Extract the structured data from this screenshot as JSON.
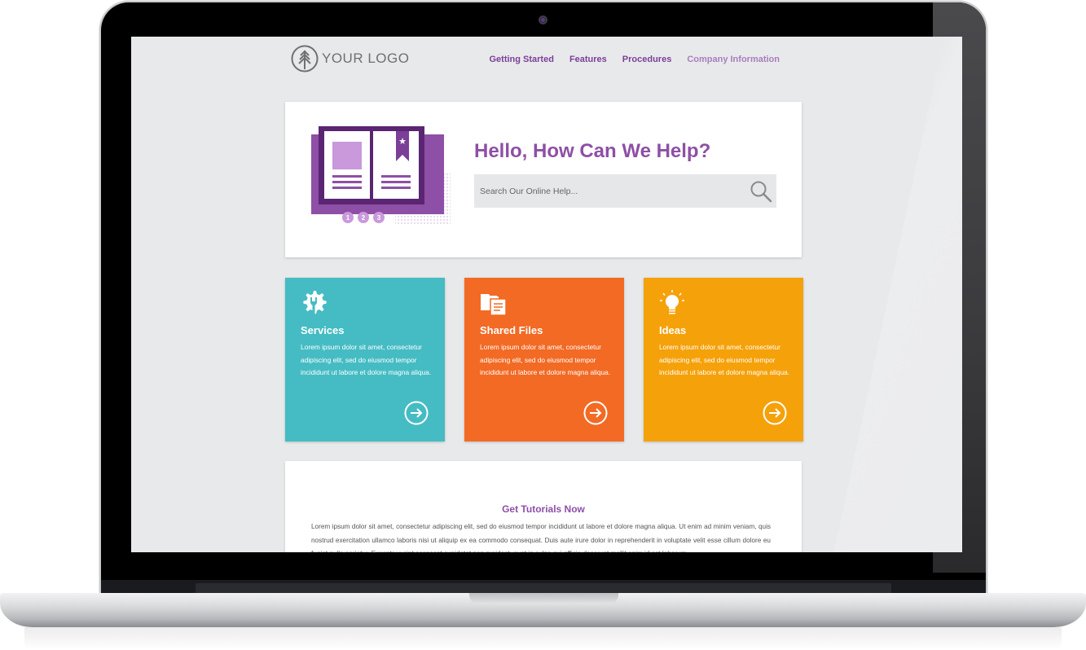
{
  "header": {
    "logo_text": "YOUR LOGO",
    "nav": [
      {
        "label": "Getting Started"
      },
      {
        "label": "Features"
      },
      {
        "label": "Procedures"
      },
      {
        "label": "Company Information"
      }
    ]
  },
  "hero": {
    "title": "Hello, How Can We Help?",
    "search_placeholder": "Search Our Online Help...",
    "search_value": "",
    "steps": [
      "1",
      "2",
      "3"
    ]
  },
  "tiles": [
    {
      "icon": "wrench-gear-icon",
      "title": "Services",
      "body": "Lorem ipsum dolor sit amet, consectetur adipiscing elit, sed do eiusmod tempor incididunt ut labore et dolore magna aliqua.",
      "color": "#45bcc3"
    },
    {
      "icon": "files-icon",
      "title": "Shared Files",
      "body": "Lorem ipsum dolor sit amet, consectetur adipiscing elit, sed do eiusmod tempor incididunt ut labore et dolore magna aliqua.",
      "color": "#f26a24"
    },
    {
      "icon": "lightbulb-icon",
      "title": "Ideas",
      "body": "Lorem ipsum dolor sit amet, consectetur adipiscing elit, sed do eiusmod tempor incididunt ut labore et dolore magna aliqua.",
      "color": "#f5a10a"
    }
  ],
  "tutorials": {
    "title": "Get Tutorials Now",
    "body": "Lorem ipsum dolor sit amet, consectetur adipiscing elit, sed do eiusmod tempor incididunt ut labore et dolore magna aliqua. Ut enim ad minim veniam, quis nostrud exercitation ullamco laboris nisi ut aliquip ex ea commodo consequat. Duis aute irure dolor in reprehenderit in voluptate velit esse cillum dolore eu fugiat nulla pariatur. Excepteur sint occaecat cupidatat non proident, sunt in culpa qui officia deserunt mollit anim id est laborum."
  },
  "colors": {
    "accent": "#8e4fa6",
    "nav": "#7b3f98",
    "background": "#e8e9eb"
  }
}
